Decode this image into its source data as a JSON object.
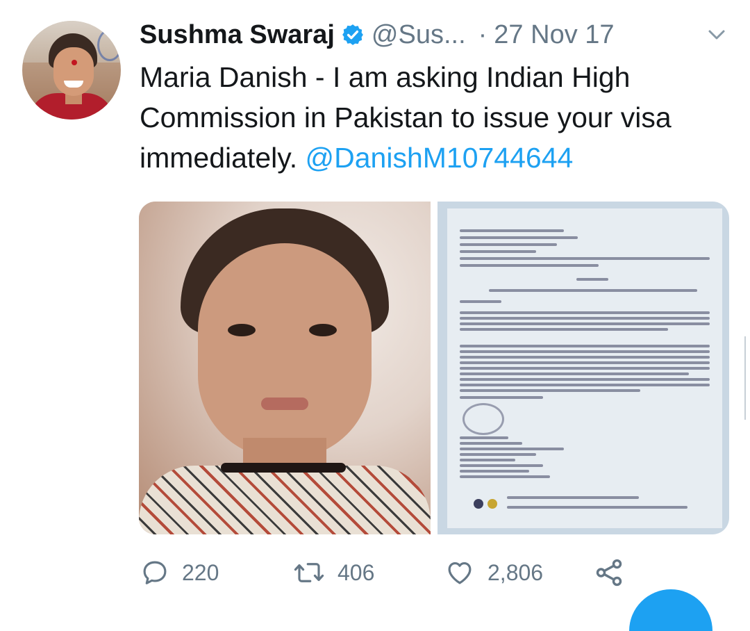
{
  "tweet": {
    "author_name": "Sushma Swaraj",
    "handle": "@Sus...",
    "separator": "·",
    "date": "27 Nov 17",
    "text": "Maria Danish - I am asking Indian High Commission in Pakistan to issue your visa immediately.",
    "mention": "@DanishM10744644"
  },
  "actions": {
    "replies": "220",
    "retweets": "406",
    "likes": "2,806"
  },
  "colors": {
    "accent": "#1da1f2",
    "muted": "#657786",
    "text": "#14171a"
  },
  "icons": [
    "verified-badge-icon",
    "chevron-down-icon",
    "reply-icon",
    "retweet-icon",
    "like-icon",
    "share-icon"
  ]
}
